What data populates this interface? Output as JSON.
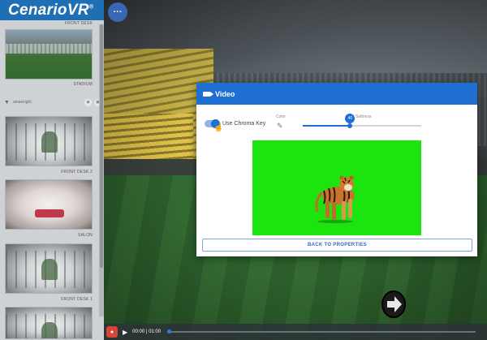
{
  "app": {
    "logo_text": "CenarioVR",
    "logo_mark": "®",
    "menu_icon_text": "···"
  },
  "sidebar": {
    "items": [
      {
        "caption": "FRONT DESK",
        "thumb": "none"
      },
      {
        "caption": "STADIUM",
        "thumb": "stadium"
      },
      {
        "caption": "FRONT DESK 2",
        "thumb": "office"
      },
      {
        "caption": "SALON",
        "thumb": "salon"
      },
      {
        "caption": "FRONT DESK 1",
        "thumb": "office"
      }
    ],
    "user_name": "amswright",
    "user_icons": [
      "location-pin-icon",
      "eye-icon",
      "lock-icon"
    ]
  },
  "video_panel": {
    "title": "Video",
    "icon": "video-camera-icon",
    "chroma_key_label": "Use Chroma Key",
    "chroma_key_enabled": true,
    "color_label": "Color",
    "color_picker_icon": "eyedropper-icon",
    "softness_label": "Softness",
    "softness_value": "40",
    "softness_fraction": 0.4,
    "back_button_label": "BACK TO PROPERTIES",
    "video_background_color": "#1ce40f"
  },
  "player": {
    "time": "00:00 | 01:00",
    "progress_fraction": 0.0
  },
  "colors": {
    "accent": "#1f6fd3",
    "logo_bar": "#1f6fb4",
    "record": "#d9443a"
  }
}
